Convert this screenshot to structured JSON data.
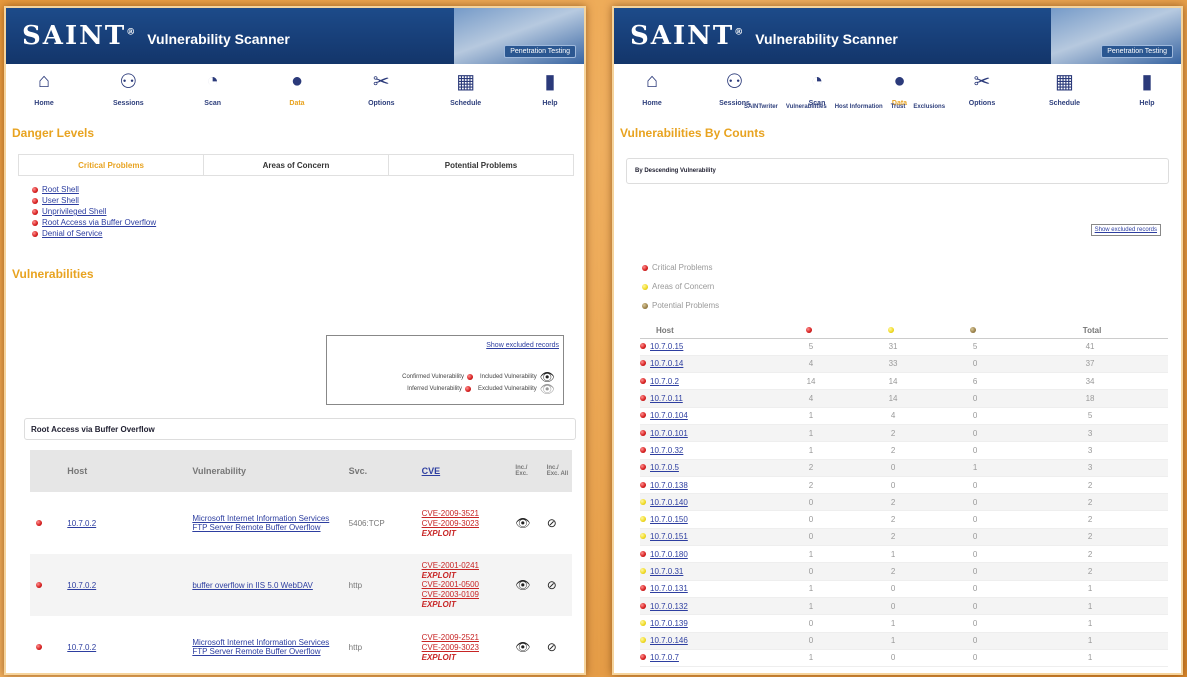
{
  "colors": {
    "accent": "#e8a320",
    "banner": "#1d4b8a",
    "critical": "#d51c1c",
    "concern": "#f0da20",
    "potential": "#9a8048",
    "link": "#2d3ea0"
  },
  "app": {
    "logo": "SAINT",
    "subtitle": "Vulnerability Scanner",
    "pen_tab": "Penetration Testing"
  },
  "left": {
    "nav": [
      {
        "label": "Home",
        "icon": "home-icon"
      },
      {
        "label": "Sessions",
        "icon": "sessions-icon"
      },
      {
        "label": "Scan",
        "icon": "scan-icon"
      },
      {
        "label": "Data",
        "icon": "data-icon",
        "active": true
      },
      {
        "label": "Options",
        "icon": "options-icon"
      },
      {
        "label": "Schedule",
        "icon": "schedule-icon"
      },
      {
        "label": "Help",
        "icon": "help-icon"
      }
    ],
    "danger_title": "Danger Levels",
    "tabs": [
      "Critical Problems",
      "Areas of Concern",
      "Potential Problems"
    ],
    "danger_items": [
      "Root Shell",
      "User Shell",
      "Unprivileged Shell",
      "Root Access via Buffer Overflow",
      "Denial of Service"
    ],
    "vuln_title": "Vulnerabilities",
    "legend": {
      "show_excluded": "Show excluded records",
      "confirmed": "Confirmed Vulnerability",
      "inferred": "Inferred Vulnerability",
      "included": "Included Vulnerability",
      "excluded": "Excluded Vulnerability"
    },
    "group_header": "Root Access via Buffer Overflow",
    "table_headers": {
      "host": "Host",
      "vuln": "Vulnerability",
      "svc": "Svc.",
      "cve": "CVE",
      "inc": "Inc./ Exc.",
      "inc_all": "Inc./ Exc. All"
    },
    "rows": [
      {
        "host": "10.7.0.2",
        "vuln": "Microsoft Internet Information Services FTP Server Remote Buffer Overflow",
        "svc": "5406:TCP",
        "cves": [
          "CVE-2009-3521",
          "CVE-2009-3023"
        ],
        "exploit": "EXPLOIT"
      },
      {
        "host": "10.7.0.2",
        "vuln": "buffer overflow in IIS 5.0 WebDAV",
        "svc": "http",
        "cves": [
          "CVE-2001-0241",
          "CVE-2001-0500",
          "CVE-2003-0109"
        ],
        "exploit": "EXPLOIT"
      },
      {
        "host": "10.7.0.2",
        "vuln": "Microsoft Internet Information Services FTP Server Remote Buffer Overflow",
        "svc": "http",
        "cves": [
          "CVE-2009-2521",
          "CVE-2009-3023"
        ],
        "exploit": "EXPLOIT"
      }
    ]
  },
  "right": {
    "nav": [
      {
        "label": "Home",
        "icon": "home-icon"
      },
      {
        "label": "Sessions",
        "icon": "sessions-icon"
      },
      {
        "label": "Scan",
        "icon": "scan-icon"
      },
      {
        "label": "Data",
        "icon": "data-icon",
        "active": true
      },
      {
        "label": "Options",
        "icon": "options-icon"
      },
      {
        "label": "Schedule",
        "icon": "schedule-icon"
      },
      {
        "label": "Help",
        "icon": "help-icon"
      }
    ],
    "subnav": [
      "SAINTwriter",
      "Vulnerabilities",
      "Host Information",
      "Trust",
      "Exclusions"
    ],
    "title": "Vulnerabilities By Counts",
    "sort_header": "By Descending Vulnerability",
    "show_excluded": "Show excluded records",
    "legend": [
      "Critical Problems",
      "Areas of Concern",
      "Potential Problems"
    ],
    "table_headers": {
      "host": "Host",
      "total": "Total"
    },
    "rows": [
      {
        "host": "10.7.0.15",
        "dot": "red",
        "c": 5,
        "a": 31,
        "p": 5,
        "t": 41
      },
      {
        "host": "10.7.0.14",
        "dot": "red",
        "c": 4,
        "a": 33,
        "p": 0,
        "t": 37
      },
      {
        "host": "10.7.0.2",
        "dot": "red",
        "c": 14,
        "a": 14,
        "p": 6,
        "t": 34
      },
      {
        "host": "10.7.0.11",
        "dot": "red",
        "c": 4,
        "a": 14,
        "p": 0,
        "t": 18
      },
      {
        "host": "10.7.0.104",
        "dot": "red",
        "c": 1,
        "a": 4,
        "p": 0,
        "t": 5
      },
      {
        "host": "10.7.0.101",
        "dot": "red",
        "c": 1,
        "a": 2,
        "p": 0,
        "t": 3
      },
      {
        "host": "10.7.0.32",
        "dot": "red",
        "c": 1,
        "a": 2,
        "p": 0,
        "t": 3
      },
      {
        "host": "10.7.0.5",
        "dot": "red",
        "c": 2,
        "a": 0,
        "p": 1,
        "t": 3
      },
      {
        "host": "10.7.0.138",
        "dot": "red",
        "c": 2,
        "a": 0,
        "p": 0,
        "t": 2
      },
      {
        "host": "10.7.0.140",
        "dot": "yellow",
        "c": 0,
        "a": 2,
        "p": 0,
        "t": 2
      },
      {
        "host": "10.7.0.150",
        "dot": "yellow",
        "c": 0,
        "a": 2,
        "p": 0,
        "t": 2
      },
      {
        "host": "10.7.0.151",
        "dot": "yellow",
        "c": 0,
        "a": 2,
        "p": 0,
        "t": 2
      },
      {
        "host": "10.7.0.180",
        "dot": "red",
        "c": 1,
        "a": 1,
        "p": 0,
        "t": 2
      },
      {
        "host": "10.7.0.31",
        "dot": "yellow",
        "c": 0,
        "a": 2,
        "p": 0,
        "t": 2
      },
      {
        "host": "10.7.0.131",
        "dot": "red",
        "c": 1,
        "a": 0,
        "p": 0,
        "t": 1
      },
      {
        "host": "10.7.0.132",
        "dot": "red",
        "c": 1,
        "a": 0,
        "p": 0,
        "t": 1
      },
      {
        "host": "10.7.0.139",
        "dot": "yellow",
        "c": 0,
        "a": 1,
        "p": 0,
        "t": 1
      },
      {
        "host": "10.7.0.146",
        "dot": "yellow",
        "c": 0,
        "a": 1,
        "p": 0,
        "t": 1
      },
      {
        "host": "10.7.0.7",
        "dot": "red",
        "c": 1,
        "a": 0,
        "p": 0,
        "t": 1
      }
    ]
  }
}
